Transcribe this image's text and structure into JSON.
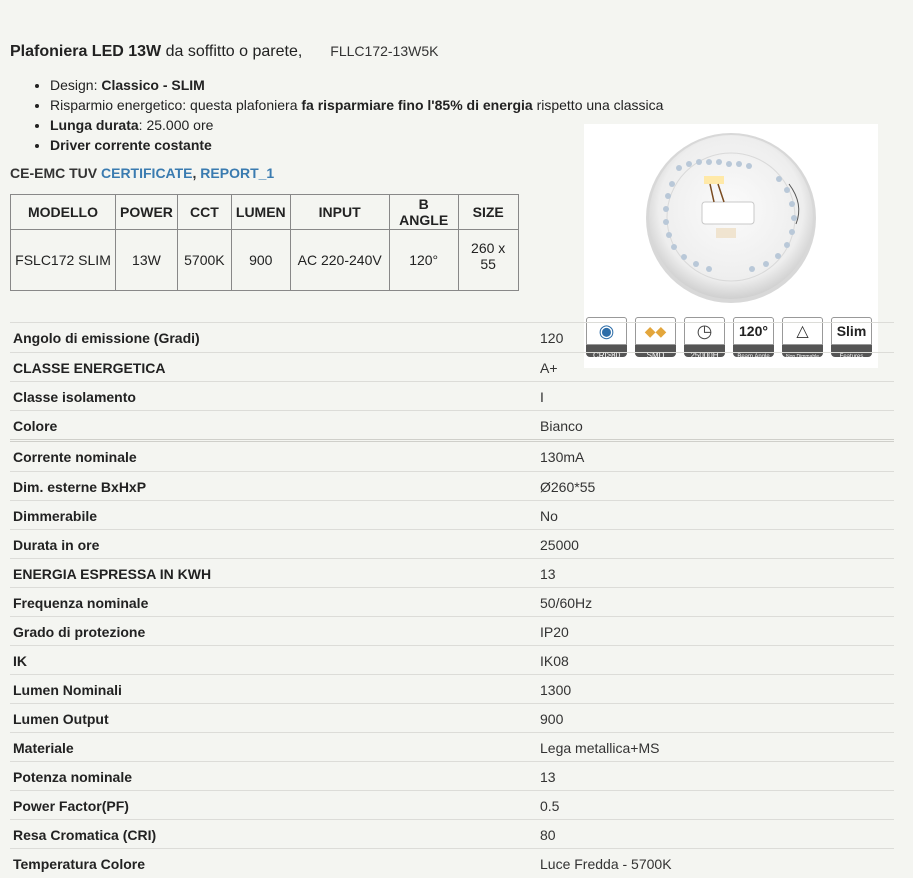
{
  "title": {
    "product": "Plafoniera LED 13W",
    "desc": " da soffitto o parete,",
    "code": "FLLC172-13W5K"
  },
  "bullets": [
    {
      "label": "Design: ",
      "value": "Classico - SLIM"
    },
    {
      "pre": "Risparmio energetico: questa plafoniera ",
      "bold": "fa risparmiare fino l'85% di energia",
      "post": " rispetto una classica"
    },
    {
      "bold": "Lunga durata",
      "rest": ": 25.000 ore"
    },
    {
      "bold": "Driver corrente costante"
    }
  ],
  "cert": {
    "prefix": "CE-EMC TUV ",
    "link1": "CERTIFICATE",
    "sep": ", ",
    "link2": "REPORT_1"
  },
  "model_table": {
    "headers": [
      "MODELLO",
      "POWER",
      "CCT",
      "LUMEN",
      "INPUT",
      "B ANGLE",
      "SIZE"
    ],
    "row": [
      "FSLC172 SLIM",
      "13W",
      "5700K",
      "900",
      "AC 220-240V",
      "120°",
      "260 x 55"
    ]
  },
  "badges": [
    {
      "label": "CRI≥80",
      "icon": "eye-icon"
    },
    {
      "label": "SMD",
      "icon": "led-chip-icon"
    },
    {
      "label": "25000H",
      "icon": "clock-icon"
    },
    {
      "label": "Beam Angle",
      "big": "120°",
      "icon": "beam-angle-icon"
    },
    {
      "label": "Non Dimmable",
      "icon": "non-dimmable-icon"
    },
    {
      "label": "Features",
      "big": "Slim",
      "icon": "slim-icon"
    }
  ],
  "specs": [
    {
      "k": "Angolo di emissione (Gradi)",
      "v": "120"
    },
    {
      "k": "CLASSE ENERGETICA",
      "v": "A+"
    },
    {
      "k": "Classe isolamento",
      "v": "I"
    },
    {
      "k": "Colore",
      "v": "Bianco"
    },
    {
      "k": "Corrente nominale",
      "v": "130mA"
    },
    {
      "k": "Dim. esterne BxHxP",
      "v": "Ø260*55"
    },
    {
      "k": "Dimmerabile",
      "v": "No"
    },
    {
      "k": "Durata in ore",
      "v": "25000"
    },
    {
      "k": "ENERGIA ESPRESSA IN KWH",
      "v": "13"
    },
    {
      "k": "Frequenza nominale",
      "v": "50/60Hz"
    },
    {
      "k": "Grado di protezione",
      "v": "IP20"
    },
    {
      "k": "IK",
      "v": "IK08"
    },
    {
      "k": "Lumen Nominali",
      "v": "1300"
    },
    {
      "k": "Lumen Output",
      "v": "900"
    },
    {
      "k": "Materiale",
      "v": "Lega metallica+MS"
    },
    {
      "k": "Potenza nominale",
      "v": "13"
    },
    {
      "k": "Power Factor(PF)",
      "v": "0.5"
    },
    {
      "k": "Resa Cromatica (CRI)",
      "v": "80"
    },
    {
      "k": "Temperatura Colore",
      "v": "Luce Fredda - 5700K"
    }
  ]
}
